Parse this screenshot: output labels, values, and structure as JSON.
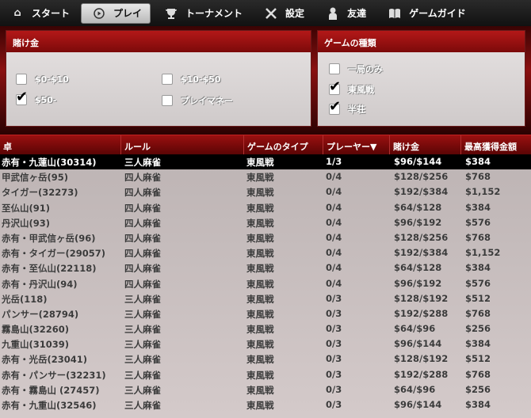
{
  "nav": [
    {
      "label": "スタート",
      "icon": "home-icon",
      "glyph": "⌂",
      "active": false
    },
    {
      "label": "プレイ",
      "icon": "play-icon",
      "glyph": "▶",
      "active": true
    },
    {
      "label": "トーナメント",
      "icon": "trophy-icon",
      "glyph": "🏆",
      "active": false
    },
    {
      "label": "設定",
      "icon": "tools-icon",
      "glyph": "✂",
      "active": false
    },
    {
      "label": "友達",
      "icon": "person-icon",
      "glyph": "●",
      "active": false
    },
    {
      "label": "ゲームガイド",
      "icon": "book-icon",
      "glyph": "▥",
      "active": false
    }
  ],
  "stakes_panel": {
    "title": "賭け金",
    "options": [
      {
        "label": "$0-$10",
        "checked": false
      },
      {
        "label": "$10-$50",
        "checked": false
      },
      {
        "label": "$50-",
        "checked": true
      },
      {
        "label": "プレイマネー",
        "checked": false
      }
    ]
  },
  "type_panel": {
    "title": "ゲームの種類",
    "options": [
      {
        "label": "一局のみ",
        "checked": false
      },
      {
        "label": "東風戦",
        "checked": true
      },
      {
        "label": "半荘",
        "checked": true
      }
    ]
  },
  "columns": [
    "卓",
    "ルール",
    "ゲームのタイプ",
    "プレーヤー▼",
    "賭け金",
    "最高獲得金額"
  ],
  "rows": [
    [
      "赤有・九蓮山(30314)",
      "三人麻雀",
      "東風戦",
      "1/3",
      "$96/$144",
      "$384"
    ],
    [
      "甲武信ヶ岳(95)",
      "四人麻雀",
      "東風戦",
      "0/4",
      "$128/$256",
      "$768"
    ],
    [
      "タイガー(32273)",
      "四人麻雀",
      "東風戦",
      "0/4",
      "$192/$384",
      "$1,152"
    ],
    [
      "至仏山(91)",
      "四人麻雀",
      "東風戦",
      "0/4",
      "$64/$128",
      "$384"
    ],
    [
      "丹沢山(93)",
      "四人麻雀",
      "東風戦",
      "0/4",
      "$96/$192",
      "$576"
    ],
    [
      "赤有・甲武信ヶ岳(96)",
      "四人麻雀",
      "東風戦",
      "0/4",
      "$128/$256",
      "$768"
    ],
    [
      "赤有・タイガー(29057)",
      "四人麻雀",
      "東風戦",
      "0/4",
      "$192/$384",
      "$1,152"
    ],
    [
      "赤有・至仏山(22118)",
      "四人麻雀",
      "東風戦",
      "0/4",
      "$64/$128",
      "$384"
    ],
    [
      "赤有・丹沢山(94)",
      "四人麻雀",
      "東風戦",
      "0/4",
      "$96/$192",
      "$576"
    ],
    [
      "光岳(118)",
      "三人麻雀",
      "東風戦",
      "0/3",
      "$128/$192",
      "$512"
    ],
    [
      "パンサー(28794)",
      "三人麻雀",
      "東風戦",
      "0/3",
      "$192/$288",
      "$768"
    ],
    [
      "霧島山(32260)",
      "三人麻雀",
      "東風戦",
      "0/3",
      "$64/$96",
      "$256"
    ],
    [
      "九重山(31039)",
      "三人麻雀",
      "東風戦",
      "0/3",
      "$96/$144",
      "$384"
    ],
    [
      "赤有・光岳(23041)",
      "三人麻雀",
      "東風戦",
      "0/3",
      "$128/$192",
      "$512"
    ],
    [
      "赤有・パンサー(32231)",
      "三人麻雀",
      "東風戦",
      "0/3",
      "$192/$288",
      "$768"
    ],
    [
      "赤有・霧島山 (27457)",
      "三人麻雀",
      "東風戦",
      "0/3",
      "$64/$96",
      "$256"
    ],
    [
      "赤有・九重山(32546)",
      "三人麻雀",
      "東風戦",
      "0/3",
      "$96/$144",
      "$384"
    ]
  ],
  "selected_row": 0
}
